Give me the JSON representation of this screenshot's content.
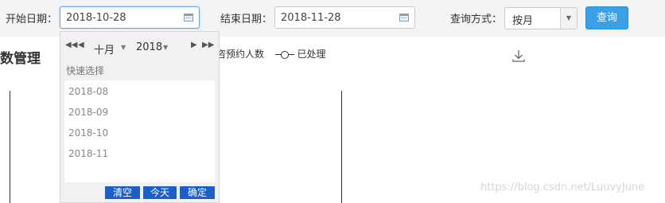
{
  "filters": {
    "start_label": "开始日期：",
    "start_value": "2018-10-28",
    "end_label": "结束日期：",
    "end_value": "2018-11-28",
    "mode_label": "查询方式：",
    "mode_value": "按月",
    "query_button": "查询"
  },
  "section": {
    "title": "数管理",
    "legend_first": "咨预约人数",
    "legend_second": "已处理"
  },
  "datepicker": {
    "month": "十月",
    "year": "2018",
    "quick_select_label": "快速选择",
    "quick_items": [
      "2018-08",
      "2018-09",
      "2018-10",
      "2018-11"
    ],
    "clear_button": "清空",
    "today_button": "今天",
    "confirm_button": "确定"
  },
  "watermark": "https://blog.csdn.net/LuuvyJune",
  "icons": [
    "calendar-icon",
    "chevron-down-icon",
    "download-icon",
    "double-chevron-left-icon",
    "chevron-left-icon",
    "chevron-right-icon",
    "double-chevron-right-icon"
  ]
}
